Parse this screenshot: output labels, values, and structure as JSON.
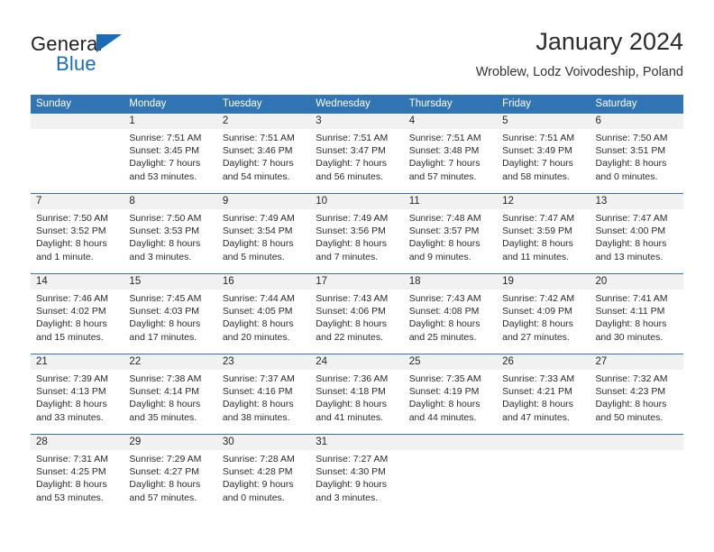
{
  "brand": {
    "name_part1": "General",
    "name_part2": "Blue",
    "logo_icon": "triangle-icon"
  },
  "header": {
    "title": "January 2024",
    "subtitle": "Wroblew, Lodz Voivodeship, Poland"
  },
  "calendar": {
    "weekday_headers": [
      "Sunday",
      "Monday",
      "Tuesday",
      "Wednesday",
      "Thursday",
      "Friday",
      "Saturday"
    ],
    "accent_color": "#3175b5",
    "daterow_color": "#f1f1f1",
    "weeks": [
      {
        "days": [
          {
            "num": "",
            "lines": []
          },
          {
            "num": "1",
            "lines": [
              "Sunrise: 7:51 AM",
              "Sunset: 3:45 PM",
              "Daylight: 7 hours",
              "and 53 minutes."
            ]
          },
          {
            "num": "2",
            "lines": [
              "Sunrise: 7:51 AM",
              "Sunset: 3:46 PM",
              "Daylight: 7 hours",
              "and 54 minutes."
            ]
          },
          {
            "num": "3",
            "lines": [
              "Sunrise: 7:51 AM",
              "Sunset: 3:47 PM",
              "Daylight: 7 hours",
              "and 56 minutes."
            ]
          },
          {
            "num": "4",
            "lines": [
              "Sunrise: 7:51 AM",
              "Sunset: 3:48 PM",
              "Daylight: 7 hours",
              "and 57 minutes."
            ]
          },
          {
            "num": "5",
            "lines": [
              "Sunrise: 7:51 AM",
              "Sunset: 3:49 PM",
              "Daylight: 7 hours",
              "and 58 minutes."
            ]
          },
          {
            "num": "6",
            "lines": [
              "Sunrise: 7:50 AM",
              "Sunset: 3:51 PM",
              "Daylight: 8 hours",
              "and 0 minutes."
            ]
          }
        ]
      },
      {
        "days": [
          {
            "num": "7",
            "lines": [
              "Sunrise: 7:50 AM",
              "Sunset: 3:52 PM",
              "Daylight: 8 hours",
              "and 1 minute."
            ]
          },
          {
            "num": "8",
            "lines": [
              "Sunrise: 7:50 AM",
              "Sunset: 3:53 PM",
              "Daylight: 8 hours",
              "and 3 minutes."
            ]
          },
          {
            "num": "9",
            "lines": [
              "Sunrise: 7:49 AM",
              "Sunset: 3:54 PM",
              "Daylight: 8 hours",
              "and 5 minutes."
            ]
          },
          {
            "num": "10",
            "lines": [
              "Sunrise: 7:49 AM",
              "Sunset: 3:56 PM",
              "Daylight: 8 hours",
              "and 7 minutes."
            ]
          },
          {
            "num": "11",
            "lines": [
              "Sunrise: 7:48 AM",
              "Sunset: 3:57 PM",
              "Daylight: 8 hours",
              "and 9 minutes."
            ]
          },
          {
            "num": "12",
            "lines": [
              "Sunrise: 7:47 AM",
              "Sunset: 3:59 PM",
              "Daylight: 8 hours",
              "and 11 minutes."
            ]
          },
          {
            "num": "13",
            "lines": [
              "Sunrise: 7:47 AM",
              "Sunset: 4:00 PM",
              "Daylight: 8 hours",
              "and 13 minutes."
            ]
          }
        ]
      },
      {
        "days": [
          {
            "num": "14",
            "lines": [
              "Sunrise: 7:46 AM",
              "Sunset: 4:02 PM",
              "Daylight: 8 hours",
              "and 15 minutes."
            ]
          },
          {
            "num": "15",
            "lines": [
              "Sunrise: 7:45 AM",
              "Sunset: 4:03 PM",
              "Daylight: 8 hours",
              "and 17 minutes."
            ]
          },
          {
            "num": "16",
            "lines": [
              "Sunrise: 7:44 AM",
              "Sunset: 4:05 PM",
              "Daylight: 8 hours",
              "and 20 minutes."
            ]
          },
          {
            "num": "17",
            "lines": [
              "Sunrise: 7:43 AM",
              "Sunset: 4:06 PM",
              "Daylight: 8 hours",
              "and 22 minutes."
            ]
          },
          {
            "num": "18",
            "lines": [
              "Sunrise: 7:43 AM",
              "Sunset: 4:08 PM",
              "Daylight: 8 hours",
              "and 25 minutes."
            ]
          },
          {
            "num": "19",
            "lines": [
              "Sunrise: 7:42 AM",
              "Sunset: 4:09 PM",
              "Daylight: 8 hours",
              "and 27 minutes."
            ]
          },
          {
            "num": "20",
            "lines": [
              "Sunrise: 7:41 AM",
              "Sunset: 4:11 PM",
              "Daylight: 8 hours",
              "and 30 minutes."
            ]
          }
        ]
      },
      {
        "days": [
          {
            "num": "21",
            "lines": [
              "Sunrise: 7:39 AM",
              "Sunset: 4:13 PM",
              "Daylight: 8 hours",
              "and 33 minutes."
            ]
          },
          {
            "num": "22",
            "lines": [
              "Sunrise: 7:38 AM",
              "Sunset: 4:14 PM",
              "Daylight: 8 hours",
              "and 35 minutes."
            ]
          },
          {
            "num": "23",
            "lines": [
              "Sunrise: 7:37 AM",
              "Sunset: 4:16 PM",
              "Daylight: 8 hours",
              "and 38 minutes."
            ]
          },
          {
            "num": "24",
            "lines": [
              "Sunrise: 7:36 AM",
              "Sunset: 4:18 PM",
              "Daylight: 8 hours",
              "and 41 minutes."
            ]
          },
          {
            "num": "25",
            "lines": [
              "Sunrise: 7:35 AM",
              "Sunset: 4:19 PM",
              "Daylight: 8 hours",
              "and 44 minutes."
            ]
          },
          {
            "num": "26",
            "lines": [
              "Sunrise: 7:33 AM",
              "Sunset: 4:21 PM",
              "Daylight: 8 hours",
              "and 47 minutes."
            ]
          },
          {
            "num": "27",
            "lines": [
              "Sunrise: 7:32 AM",
              "Sunset: 4:23 PM",
              "Daylight: 8 hours",
              "and 50 minutes."
            ]
          }
        ]
      },
      {
        "days": [
          {
            "num": "28",
            "lines": [
              "Sunrise: 7:31 AM",
              "Sunset: 4:25 PM",
              "Daylight: 8 hours",
              "and 53 minutes."
            ]
          },
          {
            "num": "29",
            "lines": [
              "Sunrise: 7:29 AM",
              "Sunset: 4:27 PM",
              "Daylight: 8 hours",
              "and 57 minutes."
            ]
          },
          {
            "num": "30",
            "lines": [
              "Sunrise: 7:28 AM",
              "Sunset: 4:28 PM",
              "Daylight: 9 hours",
              "and 0 minutes."
            ]
          },
          {
            "num": "31",
            "lines": [
              "Sunrise: 7:27 AM",
              "Sunset: 4:30 PM",
              "Daylight: 9 hours",
              "and 3 minutes."
            ]
          },
          {
            "num": "",
            "lines": []
          },
          {
            "num": "",
            "lines": []
          },
          {
            "num": "",
            "lines": []
          }
        ]
      }
    ]
  }
}
